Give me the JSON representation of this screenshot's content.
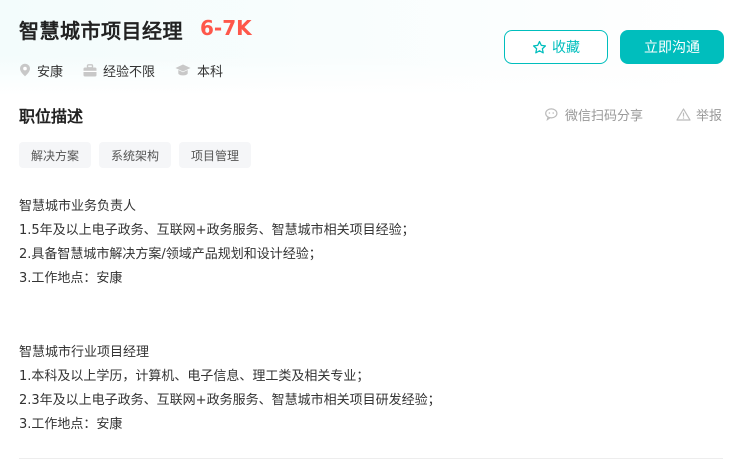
{
  "job": {
    "title": "智慧城市项目经理",
    "salary": "6-7K",
    "location": "安康",
    "experience": "经验不限",
    "education": "本科"
  },
  "actions": {
    "collect_label": "收藏",
    "chat_label": "立即沟通"
  },
  "section": {
    "title": "职位描述",
    "share_label": "微信扫码分享",
    "report_label": "举报"
  },
  "tags": [
    "解决方案",
    "系统架构",
    "项目管理"
  ],
  "description": {
    "block1": [
      "智慧城市业务负责人",
      "1.5年及以上电子政务、互联网+政务服务、智慧城市相关项目经验；",
      "2.具备智慧城市解决方案/领域产品规划和设计经验；",
      "3.工作地点：安康"
    ],
    "block2": [
      "智慧城市行业项目经理",
      "1.本科及以上学历，计算机、电子信息、理工类及相关专业；",
      "2.3年及以上电子政务、互联网+政务服务、智慧城市相关项目研发经验；",
      "3.工作地点：安康"
    ]
  },
  "colors": {
    "accent": "#00bebd",
    "salary": "#fe574a",
    "muted": "#999999"
  },
  "icons": [
    "location-icon",
    "briefcase-icon",
    "graduation-cap-icon",
    "star-icon",
    "wechat-icon",
    "warning-icon"
  ]
}
